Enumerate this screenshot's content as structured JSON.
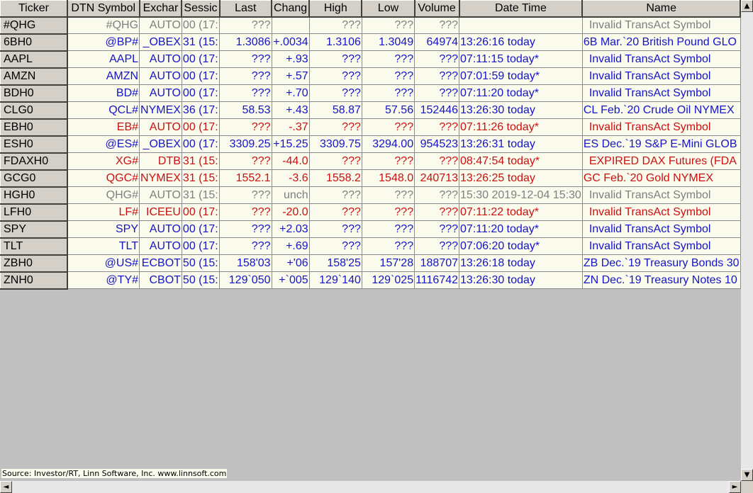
{
  "columns": [
    "Ticker",
    "DTN Symbol",
    "Exchar",
    "Sessic",
    "Last",
    "Chang",
    "High",
    "Low",
    "Volume",
    "Date Time",
    "Name"
  ],
  "colors": {
    "blue": "#1515c8",
    "red": "#cc1010",
    "gray": "#808080"
  },
  "rows": [
    {
      "ticker": "#QHG",
      "dtn": "#QHG",
      "exch": "AUTO",
      "sess": "00 (17:",
      "last": "???",
      "chg": "",
      "high": "???",
      "low": "???",
      "vol": "???",
      "dt": "",
      "name": "Invalid TransAct Symbol",
      "color": "gray",
      "indent": true
    },
    {
      "ticker": "6BH0",
      "dtn": "@BP#",
      "exch": "_OBEX",
      "sess": "31 (15:",
      "last": "1.3086",
      "chg": "+.0034",
      "high": "1.3106",
      "low": "1.3049",
      "vol": "64974",
      "dt": "13:26:16 today",
      "name": "6B Mar.`20 British Pound GLO",
      "color": "blue",
      "indent": false
    },
    {
      "ticker": "AAPL",
      "dtn": "AAPL",
      "exch": "AUTO",
      "sess": "00 (17:",
      "last": "???",
      "chg": "+.93",
      "high": "???",
      "low": "???",
      "vol": "???",
      "dt": "07:11:15 today*",
      "name": "Invalid TransAct Symbol",
      "color": "blue",
      "indent": true
    },
    {
      "ticker": "AMZN",
      "dtn": "AMZN",
      "exch": "AUTO",
      "sess": "00 (17:",
      "last": "???",
      "chg": "+.57",
      "high": "???",
      "low": "???",
      "vol": "???",
      "dt": "07:01:59 today*",
      "name": "Invalid TransAct Symbol",
      "color": "blue",
      "indent": true
    },
    {
      "ticker": "BDH0",
      "dtn": "BD#",
      "exch": "AUTO",
      "sess": "00 (17:",
      "last": "???",
      "chg": "+.70",
      "high": "???",
      "low": "???",
      "vol": "???",
      "dt": "07:11:20 today*",
      "name": "Invalid TransAct Symbol",
      "color": "blue",
      "indent": true
    },
    {
      "ticker": "CLG0",
      "dtn": "QCL#",
      "exch": "NYMEX",
      "sess": "36 (17:",
      "last": "58.53",
      "chg": "+.43",
      "high": "58.87",
      "low": "57.56",
      "vol": "152446",
      "dt": "13:26:30 today",
      "name": "CL Feb.`20 Crude Oil NYMEX",
      "color": "blue",
      "indent": false
    },
    {
      "ticker": "EBH0",
      "dtn": "EB#",
      "exch": "AUTO",
      "sess": "00 (17:",
      "last": "???",
      "chg": "-.37",
      "high": "???",
      "low": "???",
      "vol": "???",
      "dt": "07:11:26 today*",
      "name": "Invalid TransAct Symbol",
      "color": "red",
      "indent": true
    },
    {
      "ticker": "ESH0",
      "dtn": "@ES#",
      "exch": "_OBEX",
      "sess": "00 (17:",
      "last": "3309.25",
      "chg": "+15.25",
      "high": "3309.75",
      "low": "3294.00",
      "vol": "954523",
      "dt": "13:26:31 today",
      "name": "ES Dec.`19 S&P E-Mini GLOB",
      "color": "blue",
      "indent": false
    },
    {
      "ticker": "FDAXH0",
      "dtn": "XG#",
      "exch": "DTB",
      "sess": "31 (15:",
      "last": "???",
      "chg": "-44.0",
      "high": "???",
      "low": "???",
      "vol": "???",
      "dt": "08:47:54 today*",
      "name": "EXPIRED DAX Futures (FDA",
      "color": "red",
      "indent": true
    },
    {
      "ticker": "GCG0",
      "dtn": "QGC#",
      "exch": "NYMEX",
      "sess": "31 (15:",
      "last": "1552.1",
      "chg": "-3.6",
      "high": "1558.2",
      "low": "1548.0",
      "vol": "240713",
      "dt": "13:26:25 today",
      "name": "GC Feb.`20 Gold NYMEX",
      "color": "red",
      "indent": false
    },
    {
      "ticker": "HGH0",
      "dtn": "QHG#",
      "exch": "AUTO",
      "sess": "31 (15:",
      "last": "???",
      "chg": "unch",
      "high": "???",
      "low": "???",
      "vol": "???",
      "dt": "15:30 2019-12-04 15:30",
      "name": "Invalid TransAct Symbol",
      "color": "gray",
      "indent": true
    },
    {
      "ticker": "LFH0",
      "dtn": "LF#",
      "exch": "ICEEU",
      "sess": "00 (17:",
      "last": "???",
      "chg": "-20.0",
      "high": "???",
      "low": "???",
      "vol": "???",
      "dt": "07:11:22 today*",
      "name": "Invalid TransAct Symbol",
      "color": "red",
      "indent": true
    },
    {
      "ticker": "SPY",
      "dtn": "SPY",
      "exch": "AUTO",
      "sess": "00 (17:",
      "last": "???",
      "chg": "+2.03",
      "high": "???",
      "low": "???",
      "vol": "???",
      "dt": "07:11:20 today*",
      "name": "Invalid TransAct Symbol",
      "color": "blue",
      "indent": true
    },
    {
      "ticker": "TLT",
      "dtn": "TLT",
      "exch": "AUTO",
      "sess": "00 (17:",
      "last": "???",
      "chg": "+.69",
      "high": "???",
      "low": "???",
      "vol": "???",
      "dt": "07:06:20 today*",
      "name": "Invalid TransAct Symbol",
      "color": "blue",
      "indent": true
    },
    {
      "ticker": "ZBH0",
      "dtn": "@US#",
      "exch": "ECBOT",
      "sess": "50 (15:",
      "last": "158'03",
      "chg": "+'06",
      "high": "158'25",
      "low": "157'28",
      "vol": "188707",
      "dt": "13:26:18 today",
      "name": "ZB Dec.`19 Treasury Bonds 30",
      "color": "blue",
      "indent": false
    },
    {
      "ticker": "ZNH0",
      "dtn": "@TY#",
      "exch": "CBOT",
      "sess": "50 (15:",
      "last": "129`050",
      "chg": "+`005",
      "high": "129`140",
      "low": "129`025",
      "vol": "1116742",
      "dt": "13:26:30 today",
      "name": "ZN Dec.`19 Treasury Notes 10",
      "color": "blue",
      "indent": false
    }
  ],
  "footer": {
    "source": "Source: Investor/RT, Linn Software, Inc. www.linnsoft.com"
  }
}
